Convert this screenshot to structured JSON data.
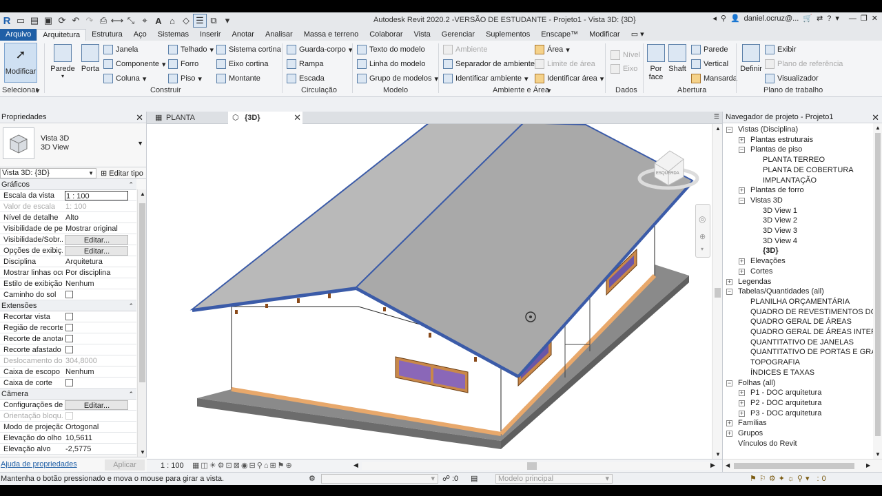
{
  "app": {
    "title": "Autodesk Revit 2020.2 -VERSÃO DE ESTUDANTE - Projeto1 - Vista 3D: {3D}",
    "user": "daniel.ocruz@...",
    "logo": "R"
  },
  "menu": [
    "Arquivo",
    "Arquitetura",
    "Estrutura",
    "Aço",
    "Sistemas",
    "Inserir",
    "Anotar",
    "Analisar",
    "Massa e terreno",
    "Colaborar",
    "Vista",
    "Gerenciar",
    "Suplementos",
    "Enscape™",
    "Modificar"
  ],
  "ribbon": {
    "modify": "Modificar",
    "wall": "Parede",
    "door": "Porta",
    "window": "Janela",
    "component": "Componente",
    "column": "Coluna",
    "roof": "Telhado",
    "ceiling": "Forro",
    "floor": "Piso",
    "curtain_system": "Sistema cortina",
    "curtain_grid": "Eixo cortina",
    "mullion": "Montante",
    "railing": "Guarda-corpo",
    "ramp": "Rampa",
    "stair": "Escada",
    "model_text": "Texto do modelo",
    "model_line": "Linha do modelo",
    "model_group": "Grupo de modelos",
    "room": "Ambiente",
    "room_separator": "Separador de ambiente",
    "tag_room": "Identificar ambiente",
    "area": "Área",
    "area_boundary": "Limite de área",
    "tag_area": "Identificar área",
    "level": "Nível",
    "grid": "Eixo",
    "by_face": "Por face",
    "shaft": "Shaft",
    "wall_open": "Parede",
    "vertical": "Vertical",
    "dormer": "Mansarda",
    "set": "Definir",
    "show": "Exibir",
    "ref_plane": "Plano de referência",
    "viewer": "Visualizador",
    "panels": {
      "select": "Selecionar",
      "build": "Construir",
      "circulation": "Circulação",
      "model": "Modelo",
      "room_area": "Ambiente e Área",
      "datum": "Dados",
      "opening": "Abertura",
      "work_plane": "Plano de trabalho"
    }
  },
  "properties": {
    "header": "Propriedades",
    "type_name": "Vista 3D",
    "type_sub": "3D View",
    "selector": "Vista 3D: {3D}",
    "edit_type": "Editar tipo",
    "sections": {
      "graphics": "Gráficos",
      "extents": "Extensões",
      "camera": "Câmera"
    },
    "graphics_rows": [
      {
        "k": "Escala da vista",
        "v": "1 : 100",
        "kind": "input"
      },
      {
        "k": "Valor de escala",
        "v": "1:  100",
        "kind": "dis"
      },
      {
        "k": "Nível de detalhe",
        "v": "Alto",
        "kind": "text"
      },
      {
        "k": "Visibilidade de pe...",
        "v": "Mostrar original",
        "kind": "text"
      },
      {
        "k": "Visibilidade/Sobr...",
        "v": "Editar...",
        "kind": "btn"
      },
      {
        "k": "Opções de exibiç...",
        "v": "Editar...",
        "kind": "btn"
      },
      {
        "k": "Disciplina",
        "v": "Arquitetura",
        "kind": "text"
      },
      {
        "k": "Mostrar linhas ocu...",
        "v": "Por disciplina",
        "kind": "text"
      },
      {
        "k": "Estilo de exibição ...",
        "v": "Nenhum",
        "kind": "text"
      },
      {
        "k": "Caminho do sol",
        "v": "",
        "kind": "chk"
      }
    ],
    "extents_rows": [
      {
        "k": "Recortar vista",
        "v": "",
        "kind": "chk"
      },
      {
        "k": "Região de recorte...",
        "v": "",
        "kind": "chk"
      },
      {
        "k": "Recorte de anotaç...",
        "v": "",
        "kind": "chk"
      },
      {
        "k": "Recorte afastado ...",
        "v": "",
        "kind": "chk"
      },
      {
        "k": "Deslocamento do...",
        "v": "304,8000",
        "kind": "dis"
      },
      {
        "k": "Caixa de escopo",
        "v": "Nenhum",
        "kind": "text"
      },
      {
        "k": "Caixa de corte",
        "v": "",
        "kind": "chk"
      }
    ],
    "camera_rows": [
      {
        "k": "Configurações de ...",
        "v": "Editar...",
        "kind": "btn"
      },
      {
        "k": "Orientação bloqu...",
        "v": "",
        "kind": "chkdis"
      },
      {
        "k": "Modo de projeção",
        "v": "Ortogonal",
        "kind": "text"
      },
      {
        "k": "Elevação do olho",
        "v": "10,5611",
        "kind": "text"
      },
      {
        "k": "Elevação alvo",
        "v": "-2,5775",
        "kind": "text"
      }
    ],
    "help_link": "Ajuda de propriedades",
    "apply": "Aplicar"
  },
  "tabs": [
    {
      "label": "PLANTA TERREO",
      "active": false
    },
    {
      "label": "{3D}",
      "active": true
    }
  ],
  "viewcube_label": "ESQUERDA",
  "view_scale": "1 : 100",
  "browser": {
    "header": "Navegador de projeto - Projeto1",
    "items": [
      {
        "label": "Vistas (Disciplina)",
        "level": 0,
        "tog": "-"
      },
      {
        "label": "Plantas estruturais",
        "level": 1,
        "tog": "+"
      },
      {
        "label": "Plantas de piso",
        "level": 1,
        "tog": "-"
      },
      {
        "label": "PLANTA TERREO",
        "level": 2,
        "tog": ""
      },
      {
        "label": "PLANTA DE COBERTURA",
        "level": 2,
        "tog": ""
      },
      {
        "label": "IMPLANTAÇÃO",
        "level": 2,
        "tog": ""
      },
      {
        "label": "Plantas de forro",
        "level": 1,
        "tog": "+"
      },
      {
        "label": "Vistas 3D",
        "level": 1,
        "tog": "-"
      },
      {
        "label": "3D View 1",
        "level": 2,
        "tog": ""
      },
      {
        "label": "3D View 2",
        "level": 2,
        "tog": ""
      },
      {
        "label": "3D View 3",
        "level": 2,
        "tog": ""
      },
      {
        "label": "3D View 4",
        "level": 2,
        "tog": ""
      },
      {
        "label": "{3D}",
        "level": 2,
        "tog": "",
        "bold": true
      },
      {
        "label": "Elevações",
        "level": 1,
        "tog": "+"
      },
      {
        "label": "Cortes",
        "level": 1,
        "tog": "+"
      },
      {
        "label": "Legendas",
        "level": 0,
        "tog": "+"
      },
      {
        "label": "Tabelas/Quantidades (all)",
        "level": 0,
        "tog": "-"
      },
      {
        "label": "PLANILHA ORÇAMENTÁRIA",
        "level": 1,
        "tog": ""
      },
      {
        "label": "QUADRO DE REVESTIMENTOS DOS AMBIENTES",
        "level": 1,
        "tog": ""
      },
      {
        "label": "QUADRO GERAL DE ÁREAS",
        "level": 1,
        "tog": ""
      },
      {
        "label": "QUADRO GERAL DE ÁREAS INTERNAS",
        "level": 1,
        "tog": ""
      },
      {
        "label": "QUANTITATIVO DE JANELAS",
        "level": 1,
        "tog": ""
      },
      {
        "label": "QUANTITATIVO DE PORTAS E GRADIS",
        "level": 1,
        "tog": ""
      },
      {
        "label": "TOPOGRAFIA",
        "level": 1,
        "tog": ""
      },
      {
        "label": "ÍNDICES E TAXAS",
        "level": 1,
        "tog": ""
      },
      {
        "label": "Folhas (all)",
        "level": 0,
        "tog": "-"
      },
      {
        "label": "P1 - DOC arquitetura",
        "level": 1,
        "tog": "+"
      },
      {
        "label": "P2 - DOC arquitetura",
        "level": 1,
        "tog": "+"
      },
      {
        "label": "P3 - DOC arquitetura",
        "level": 1,
        "tog": "+"
      },
      {
        "label": "Famílias",
        "level": 0,
        "tog": "+"
      },
      {
        "label": "Grupos",
        "level": 0,
        "tog": "+"
      },
      {
        "label": "Vínculos do Revit",
        "level": 0,
        "tog": ""
      }
    ]
  },
  "status": {
    "message": "Mantenha o botão pressionado e mova o mouse para girar a vista.",
    "count": ":0",
    "model": "Modelo principal"
  },
  "colors": {
    "accent": "#1f5fa6",
    "roof": "#b6b6b6",
    "roof_edge": "#3b5ba8",
    "slab": "#7a7a7a",
    "wood": "#e8a86b"
  }
}
